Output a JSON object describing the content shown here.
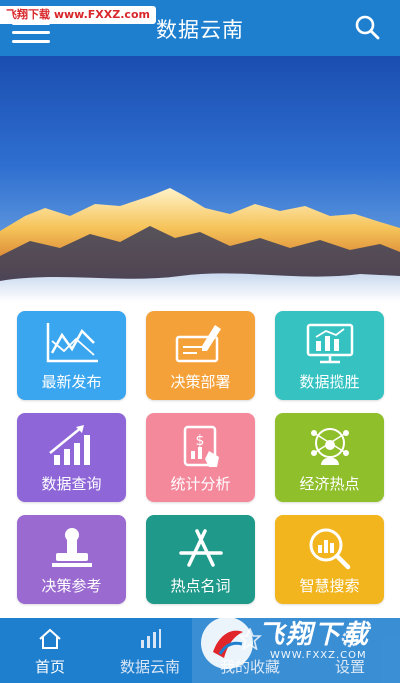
{
  "header": {
    "title": "数据云南",
    "watermark": "飞翔下载 www.FXXZ.com"
  },
  "tiles": [
    {
      "label": "最新发布",
      "icon": "line-chart-icon",
      "color": "#3aa6ef"
    },
    {
      "label": "决策部署",
      "icon": "signing-check-icon",
      "color": "#f5a13a"
    },
    {
      "label": "数据揽胜",
      "icon": "monitor-chart-icon",
      "color": "#35c2c1"
    },
    {
      "label": "数据查询",
      "icon": "growth-bars-icon",
      "color": "#8e66d8"
    },
    {
      "label": "统计分析",
      "icon": "tablet-dollar-icon",
      "color": "#f4899c"
    },
    {
      "label": "经济热点",
      "icon": "network-person-icon",
      "color": "#8fbf2a"
    },
    {
      "label": "决策参考",
      "icon": "stamp-icon",
      "color": "#9b6ad0"
    },
    {
      "label": "热点名词",
      "icon": "appstore-tools-icon",
      "color": "#1f9a8a"
    },
    {
      "label": "智慧搜索",
      "icon": "magnifier-chart-icon",
      "color": "#f2b51e"
    }
  ],
  "nav": {
    "items": [
      {
        "label": "首页",
        "icon": "home-icon"
      },
      {
        "label": "数据云南",
        "icon": "bars-icon"
      },
      {
        "label": "我的收藏",
        "icon": "star-icon"
      },
      {
        "label": "设置",
        "icon": "gear-icon"
      }
    ]
  },
  "watermark_bottom": {
    "text": "飞翔下载",
    "url": "WWW.FXXZ.COM"
  }
}
